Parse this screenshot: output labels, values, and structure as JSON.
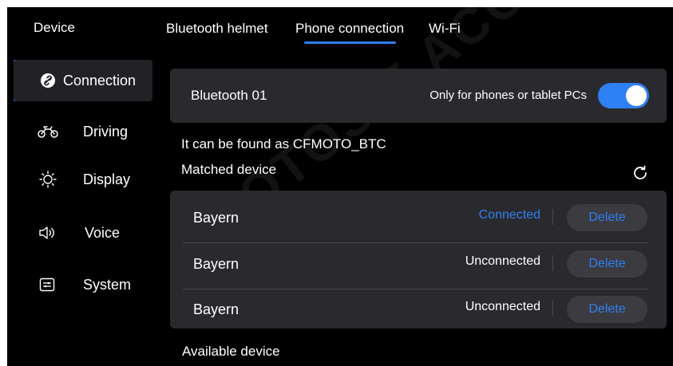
{
  "header": {
    "device_label": "Device",
    "tabs": [
      {
        "label": "Bluetooth helmet"
      },
      {
        "label": "Phone connection",
        "active": true
      },
      {
        "label": "Wi-Fi"
      }
    ]
  },
  "sidebar": {
    "items": [
      {
        "label": "Connection",
        "icon": "link-icon",
        "active": true
      },
      {
        "label": "Driving",
        "icon": "motorcycle-icon"
      },
      {
        "label": "Display",
        "icon": "brightness-icon"
      },
      {
        "label": "Voice",
        "icon": "speaker-icon"
      },
      {
        "label": "System",
        "icon": "system-settings-icon"
      }
    ]
  },
  "bluetooth": {
    "name": "Bluetooth 01",
    "hint": "Only for phones or tablet PCs",
    "toggle_on": true
  },
  "discoverable_text": "It can be found as CFMOTO_BTC",
  "matched": {
    "title": "Matched device",
    "devices": [
      {
        "name": "Bayern",
        "status": "Connected",
        "action": "Delete"
      },
      {
        "name": "Bayern",
        "status": "Unconnected",
        "action": "Delete"
      },
      {
        "name": "Bayern",
        "status": "Unconnected",
        "action": "Delete"
      }
    ]
  },
  "available_title": "Available device",
  "watermark_text": "MOTOS E ACCESSORIOS",
  "colors": {
    "background": "#000000",
    "card": "#2a2a2e",
    "accent": "#2f7ff5",
    "text": "#ffffff"
  }
}
